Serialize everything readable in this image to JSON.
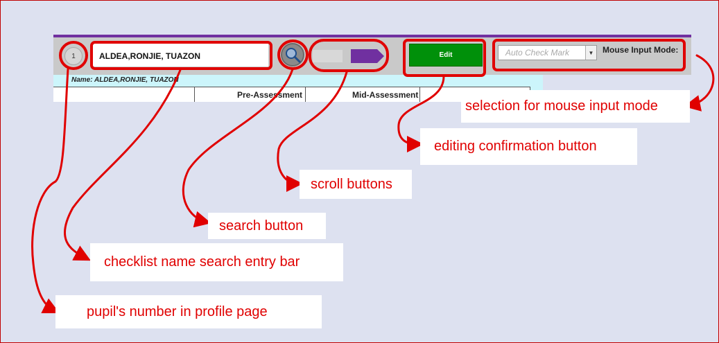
{
  "profile": {
    "pupil_number": "1",
    "search_value": "ALDEA,RONJIE, TUAZON",
    "name_label": "Name: ALDEA,RONJIE, TUAZON"
  },
  "sheet": {
    "columns": [
      "",
      "Pre-Assessment",
      "Mid-Assessment",
      ""
    ]
  },
  "toolbar": {
    "edit_label": "Edit",
    "mode_select_value": "Auto Check Mark",
    "mode_label": "Mouse Input Mode:",
    "accent_color": "#7030a0",
    "edit_color": "#00900a",
    "highlight_color": "#e00000"
  },
  "icons": {
    "search": "search-icon",
    "scroll_left": "scroll-left-button",
    "scroll_right": "scroll-right-arrow-icon",
    "dropdown": "chevron-down-icon"
  },
  "callouts": {
    "mouse_mode": "selection for mouse input mode",
    "edit": "editing confirmation button",
    "scroll": "scroll buttons",
    "search": "search button",
    "entry": "checklist name search entry bar",
    "pupil_number": "pupil's number in profile page"
  }
}
